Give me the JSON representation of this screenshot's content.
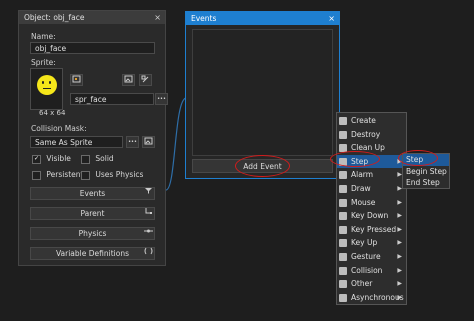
{
  "object_panel": {
    "title": "Object: obj_face",
    "close": "×",
    "name_label": "Name:",
    "name_value": "obj_face",
    "sprite_label": "Sprite:",
    "sprite_name": "spr_face",
    "sprite_size": "64 x 64",
    "more_btn": "•••",
    "collision_label": "Collision Mask:",
    "collision_value": "Same As Sprite",
    "visible_label": "Visible",
    "solid_label": "Solid",
    "persistent_label": "Persistent",
    "uses_physics_label": "Uses Physics",
    "buttons": {
      "events": "Events",
      "parent": "Parent",
      "physics": "Physics",
      "variable_definitions": "Variable Definitions"
    }
  },
  "events_panel": {
    "title": "Events",
    "close": "×",
    "add_event": "Add Event"
  },
  "event_menu": [
    {
      "label": "Create",
      "arrow": false
    },
    {
      "label": "Destroy",
      "arrow": false
    },
    {
      "label": "Clean Up",
      "arrow": false
    },
    {
      "label": "Step",
      "arrow": true
    },
    {
      "label": "Alarm",
      "arrow": true
    },
    {
      "label": "Draw",
      "arrow": true
    },
    {
      "label": "Mouse",
      "arrow": true
    },
    {
      "label": "Key Down",
      "arrow": true
    },
    {
      "label": "Key Pressed",
      "arrow": true
    },
    {
      "label": "Key Up",
      "arrow": true
    },
    {
      "label": "Gesture",
      "arrow": true
    },
    {
      "label": "Collision",
      "arrow": true
    },
    {
      "label": "Other",
      "arrow": true
    },
    {
      "label": "Asynchronous",
      "arrow": true
    }
  ],
  "step_submenu": [
    "Step",
    "Begin Step",
    "End Step"
  ],
  "arrow_glyph": "▶",
  "colors": {
    "accent": "#1e5a9a",
    "highlight_ring": "#d01c1c",
    "sprite_face": "#f5e61a"
  }
}
